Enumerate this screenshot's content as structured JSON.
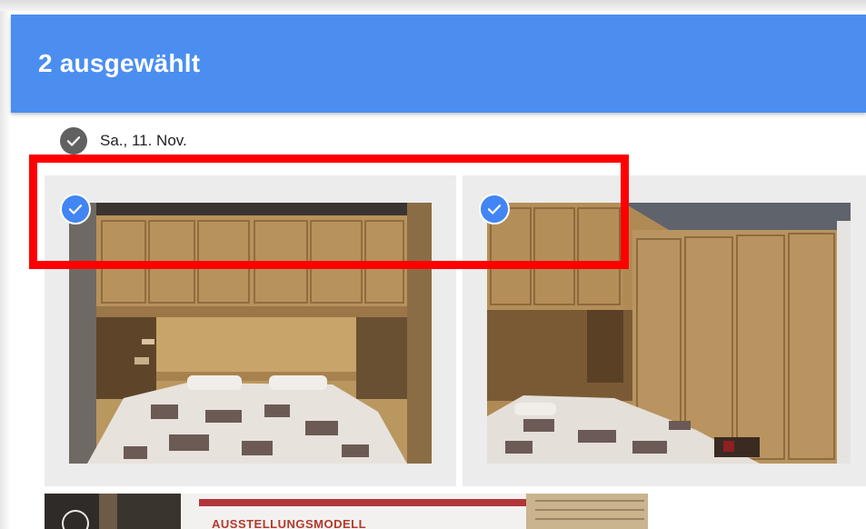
{
  "header": {
    "title": "2 ausgewählt"
  },
  "date_group": {
    "label": "Sa., 11. Nov.",
    "icon": "check-circle-icon",
    "selected": true
  },
  "photos": [
    {
      "selected": true,
      "icon": "check-circle-icon"
    },
    {
      "selected": true,
      "icon": "check-circle-icon"
    },
    {
      "selected": false,
      "caption": "AUSSTELLUNGSMODELL"
    }
  ],
  "colors": {
    "header": "#4b8ef0",
    "check": "#4285f4",
    "highlight": "#ff0000"
  }
}
